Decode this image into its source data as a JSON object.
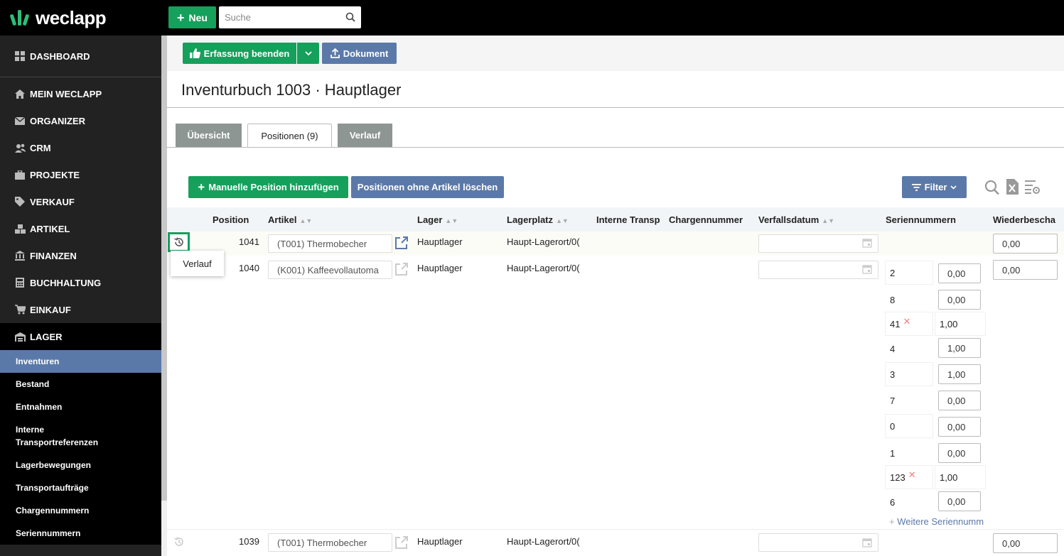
{
  "app": {
    "name": "weclapp"
  },
  "header": {
    "new_label": "Neu",
    "search_placeholder": "Suche"
  },
  "sidebar": {
    "dashboard": "DASHBOARD",
    "items": [
      "MEIN WECLAPP",
      "ORGANIZER",
      "CRM",
      "PROJEKTE",
      "VERKAUF",
      "ARTIKEL",
      "FINANZEN",
      "BUCHHALTUNG",
      "EINKAUF"
    ],
    "lager": "LAGER",
    "sub": [
      "Inventuren",
      "Bestand",
      "Entnahmen",
      "Interne Transportreferenzen",
      "Lagerbewegungen",
      "Transportaufträge",
      "Chargennummern",
      "Seriennummern"
    ],
    "active_sub": "Inventuren"
  },
  "toolbar": {
    "finish_label": "Erfassung beenden",
    "document_label": "Dokument"
  },
  "page": {
    "title": "Inventurbuch 1003 · Hauptlager"
  },
  "tabs": [
    {
      "label": "Übersicht",
      "active": false
    },
    {
      "label": "Positionen (9)",
      "active": true
    },
    {
      "label": "Verlauf",
      "active": false
    }
  ],
  "actions": {
    "add_manual": "Manuelle Position hinzufügen",
    "delete_without_article": "Positionen ohne Artikel löschen",
    "filter": "Filter"
  },
  "table": {
    "columns": [
      "Position",
      "Artikel",
      "Lager",
      "Lagerplatz",
      "Interne Transp",
      "Chargennummer",
      "Verfallsdatum",
      "Seriennummern",
      "Wiederbescha"
    ],
    "rows": [
      {
        "position": "1041",
        "artikel": "(T001) Thermobecher",
        "lager": "Hauptlager",
        "lagerplatz": "Haupt-Lagerort/0(",
        "wiederbeschaffung": "0,00"
      },
      {
        "position": "1040",
        "artikel": "(K001) Kaffeevollautoma",
        "lager": "Hauptlager",
        "lagerplatz": "Haupt-Lagerort/0(",
        "wiederbeschaffung": "0,00"
      },
      {
        "position": "1039",
        "artikel": "(T001) Thermobecher",
        "lager": "Hauptlager",
        "lagerplatz": "Haupt-Lagerort/0(",
        "wiederbeschaffung": "0,00"
      }
    ],
    "serials": [
      {
        "nr": "2",
        "qty": "0,00",
        "removable": false
      },
      {
        "nr": "8",
        "qty": "0,00",
        "removable": false
      },
      {
        "nr": "41",
        "qty": "1,00",
        "removable": true
      },
      {
        "nr": "4",
        "qty": "1,00",
        "removable": false
      },
      {
        "nr": "3",
        "qty": "1,00",
        "removable": false
      },
      {
        "nr": "7",
        "qty": "0,00",
        "removable": false
      },
      {
        "nr": "0",
        "qty": "0,00",
        "removable": false
      },
      {
        "nr": "1",
        "qty": "0,00",
        "removable": false
      },
      {
        "nr": "123",
        "qty": "1,00",
        "removable": true
      },
      {
        "nr": "6",
        "qty": "0,00",
        "removable": false
      }
    ],
    "more_serials": "Weitere Seriennumm"
  },
  "tooltip": {
    "text": "Verlauf"
  },
  "colors": {
    "green": "#15a05c",
    "blue": "#5b79a8",
    "sidebar": "#222222",
    "tab_inactive": "#8e9694"
  }
}
